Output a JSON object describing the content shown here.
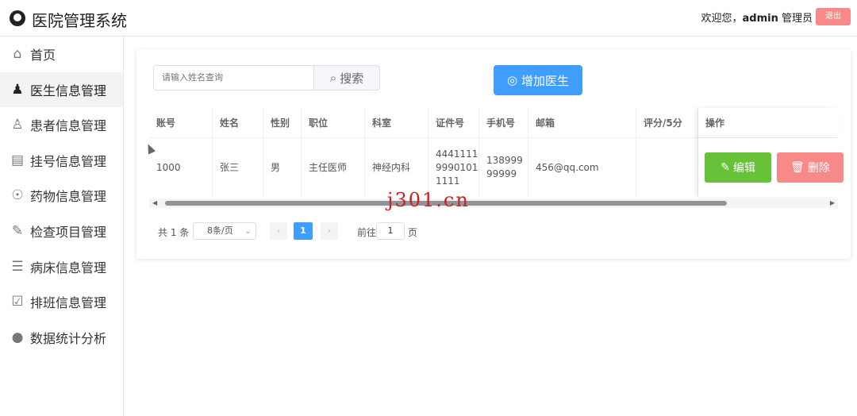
{
  "header": {
    "logo_icon": "doctor-logo-icon",
    "title": "医院管理系统",
    "welcome_prefix": "欢迎您，",
    "username": "admin",
    "role": " 管理员",
    "logout_label": "退出"
  },
  "sidebar": {
    "items": [
      {
        "label": "首页",
        "icon": "home-icon"
      },
      {
        "label": "医生信息管理",
        "icon": "doctor-icon"
      },
      {
        "label": "患者信息管理",
        "icon": "patient-icon"
      },
      {
        "label": "挂号信息管理",
        "icon": "registration-icon"
      },
      {
        "label": "药物信息管理",
        "icon": "medicine-icon"
      },
      {
        "label": "检查项目管理",
        "icon": "checklist-icon"
      },
      {
        "label": "病床信息管理",
        "icon": "list-icon"
      },
      {
        "label": "排班信息管理",
        "icon": "schedule-icon"
      },
      {
        "label": "数据统计分析",
        "icon": "analysis-icon"
      }
    ]
  },
  "toolbar": {
    "search_placeholder": "请输入姓名查询",
    "search_label": "搜索",
    "add_label": "增加医生"
  },
  "table": {
    "columns": [
      "账号",
      "姓名",
      "性别",
      "职位",
      "科室",
      "证件号",
      "手机号",
      "邮箱",
      "评分/5分",
      "操作"
    ],
    "rows": [
      {
        "account": "1000",
        "name": "张三",
        "gender": "男",
        "position": "主任医师",
        "department": "神经内科",
        "id_number": "444111199901011111",
        "phone": "13899999999",
        "email": "456@qq.com",
        "score": ""
      }
    ],
    "edit_label": "编辑",
    "delete_label": "删除"
  },
  "pagination": {
    "total": "共 1 条",
    "page_size": "8条/页",
    "current_page": "1",
    "goto_label": "前往",
    "goto_value": "1",
    "page_unit": "页"
  },
  "watermark": "j301.cn"
}
